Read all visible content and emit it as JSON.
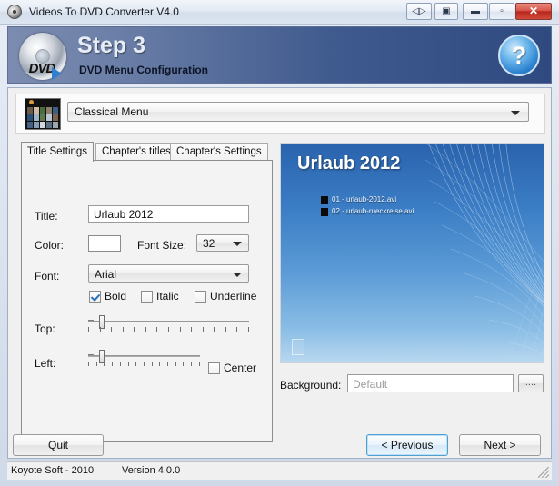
{
  "window": {
    "title": "Videos To DVD Converter V4.0",
    "icon": "dvd-disc-icon",
    "controls": {
      "nav": "◁▷",
      "restore_group": "▣",
      "minimize": "▬",
      "maximize": "▫",
      "close": "✕"
    }
  },
  "header": {
    "step_title": "Step 3",
    "subtitle": "DVD Menu Configuration",
    "disc_label": "DVD",
    "help_label": "?",
    "accent": "#2f4a80"
  },
  "chooser": {
    "selected_menu": "Classical Menu",
    "thumbnail": "menu-thumbnail-icon"
  },
  "tabs": [
    {
      "label": "Title Settings",
      "active": true
    },
    {
      "label": "Chapter's titles",
      "active": false
    },
    {
      "label": "Chapter's Settings",
      "active": false
    }
  ],
  "title_settings": {
    "title_label": "Title:",
    "title_value": "Urlaub 2012",
    "color_label": "Color:",
    "color_value": "#ffffff",
    "font_size_label": "Font Size:",
    "font_size_value": "32",
    "font_label": "Font:",
    "font_value": "Arial",
    "bold_label": "Bold",
    "bold_checked": true,
    "italic_label": "Italic",
    "italic_checked": false,
    "underline_label": "Underline",
    "underline_checked": false,
    "top_label": "Top:",
    "left_label": "Left:",
    "center_label": "Center",
    "center_checked": false
  },
  "preview": {
    "menu_title": "Urlaub 2012",
    "items": [
      {
        "label": "01 - urlaub-2012.avi"
      },
      {
        "label": "02 - urlaub-rueckreise.avi"
      }
    ],
    "background_color": "#3a7cc4"
  },
  "background_row": {
    "label": "Background:",
    "placeholder": "Default",
    "browse_label": "...."
  },
  "footer": {
    "quit_label": "Quit",
    "previous_label": "< Previous",
    "next_label": "Next >"
  },
  "statusbar": {
    "company": "Koyote Soft - 2010",
    "version": "Version 4.0.0"
  }
}
